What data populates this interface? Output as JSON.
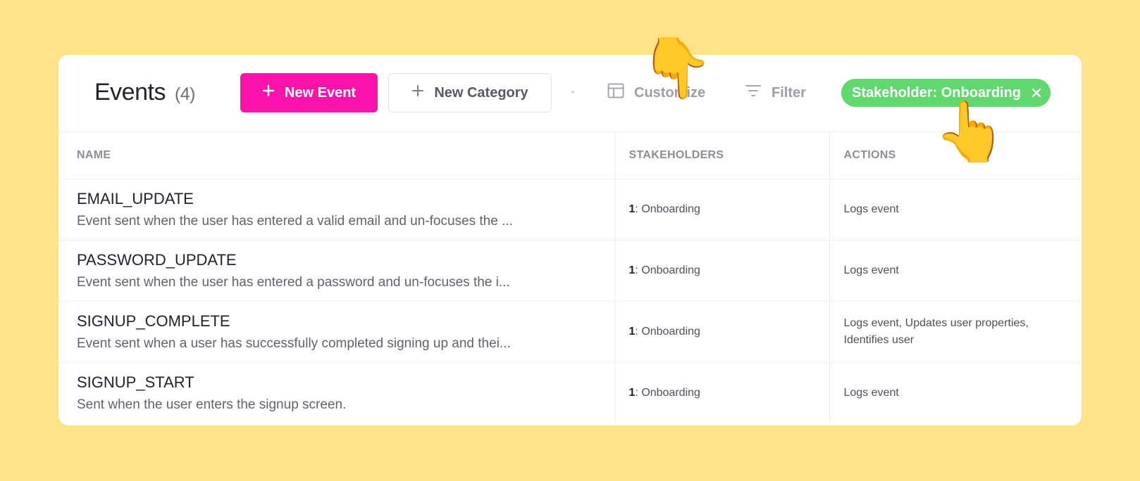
{
  "header": {
    "title": "Events",
    "count": "(4)",
    "new_event_label": "New Event",
    "new_category_label": "New Category",
    "customize_label": "Customize",
    "filter_label": "Filter",
    "active_filter_chip": "Stakeholder: Onboarding"
  },
  "colors": {
    "background": "#ffe388",
    "primary_button": "#fb13ac",
    "filter_chip": "#5fd96d"
  },
  "table": {
    "columns": [
      "NAME",
      "STAKEHOLDERS",
      "ACTIONS"
    ],
    "rows": [
      {
        "name": "EMAIL_UPDATE",
        "description": "Event sent when the user has entered a valid email and un-focuses the ...",
        "stakeholder_count": "1",
        "stakeholder_sep": ":",
        "stakeholder": "Onboarding",
        "actions": "Logs event"
      },
      {
        "name": "PASSWORD_UPDATE",
        "description": "Event sent when the user has entered a password and un-focuses the i...",
        "stakeholder_count": "1",
        "stakeholder_sep": ":",
        "stakeholder": "Onboarding",
        "actions": "Logs event"
      },
      {
        "name": "SIGNUP_COMPLETE",
        "description": "Event sent when a user has successfully completed signing up and thei...",
        "stakeholder_count": "1",
        "stakeholder_sep": ":",
        "stakeholder": "Onboarding",
        "actions": "Logs event, Updates user properties, Identifies user"
      },
      {
        "name": "SIGNUP_START",
        "description": "Sent when the user enters the signup screen.",
        "stakeholder_count": "1",
        "stakeholder_sep": ":",
        "stakeholder": "Onboarding",
        "actions": "Logs event"
      }
    ]
  },
  "icons": {
    "new_event": "plus-icon",
    "new_category": "plus-icon",
    "customize": "table-columns-icon",
    "filter": "filter-lines-icon",
    "chip_close": "close-icon",
    "pointer_down": "hand-pointing-down-icon",
    "pointer_up": "hand-pointing-up-icon"
  },
  "pointers": {
    "down_glyph": "👇",
    "up_glyph": "👆"
  }
}
